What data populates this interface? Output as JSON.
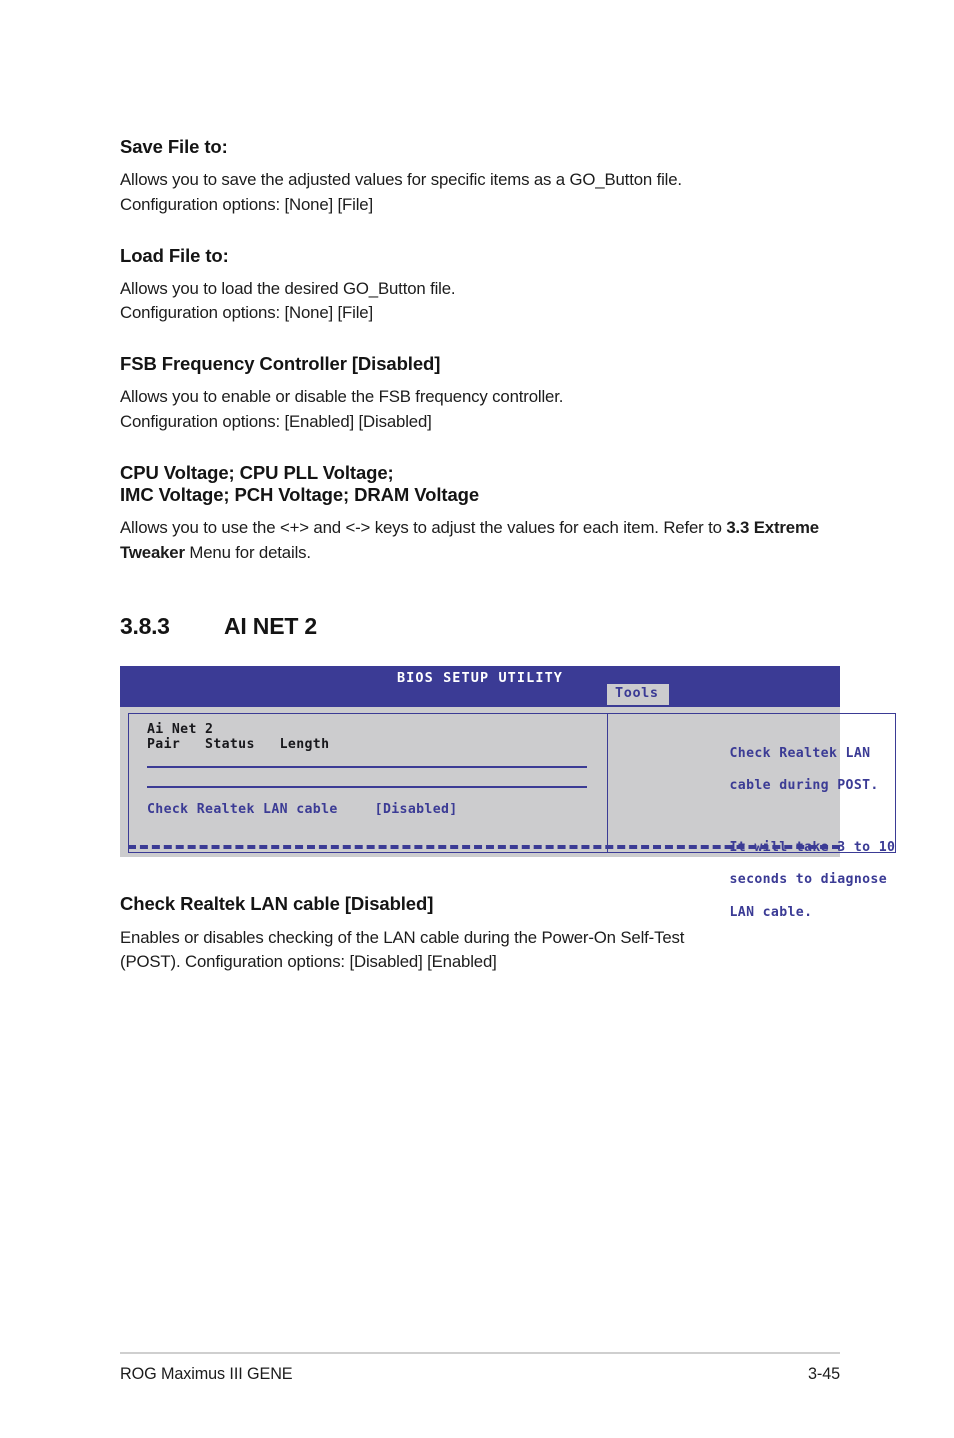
{
  "colors": {
    "bios_header_bg": "#3b3b95",
    "bios_body_bg": "#ccccce",
    "bios_blue_text": "#3b3b95",
    "bios_dark_text": "#18181c",
    "footer_rule": "#cfcfcf"
  },
  "sections": [
    {
      "heading": "Save File to:",
      "lines": [
        "Allows you to save the adjusted values for specific items as a GO_Button file.",
        "Configuration options: [None] [File]"
      ]
    },
    {
      "heading": "Load File to:",
      "lines": [
        "Allows you to load the desired GO_Button file.",
        "Configuration options: [None] [File]"
      ]
    },
    {
      "heading": "FSB Frequency Controller [Disabled]",
      "lines": [
        "Allows you to enable or disable the FSB frequency controller.",
        "Configuration options: [Enabled] [Disabled]"
      ]
    }
  ],
  "voltage_block": {
    "heading_line1": "CPU Voltage; CPU PLL Voltage;",
    "heading_line2": "IMC Voltage; PCH Voltage; DRAM Voltage",
    "text_before": "Allows you to use the <+> and <-> keys to adjust the values for each item. Refer to ",
    "text_bold": "3.3 Extreme Tweaker",
    "text_after": " Menu for details."
  },
  "section_heading": {
    "number": "3.8.3",
    "title": "AI NET 2"
  },
  "bios": {
    "title": "BIOS SETUP UTILITY",
    "tab": "Tools",
    "left": {
      "group_title": "Ai Net 2",
      "column_headers": "Pair   Status   Length",
      "item_label": "Check Realtek LAN cable",
      "item_value": "[Disabled]"
    },
    "help": {
      "paragraph1_line1": "Check Realtek LAN",
      "paragraph1_line2": "cable during POST.",
      "paragraph2_line1": "It will take 3 to 10",
      "paragraph2_line2": "seconds to diagnose",
      "paragraph2_line3": "LAN cable."
    }
  },
  "after_bios": {
    "heading": "Check Realtek LAN cable [Disabled]",
    "lines": [
      "Enables or disables checking of the LAN cable during the Power-On Self-Test",
      "(POST). Configuration options: [Disabled] [Enabled]"
    ]
  },
  "footer": {
    "product": "ROG Maximus III GENE",
    "page": "3-45"
  }
}
